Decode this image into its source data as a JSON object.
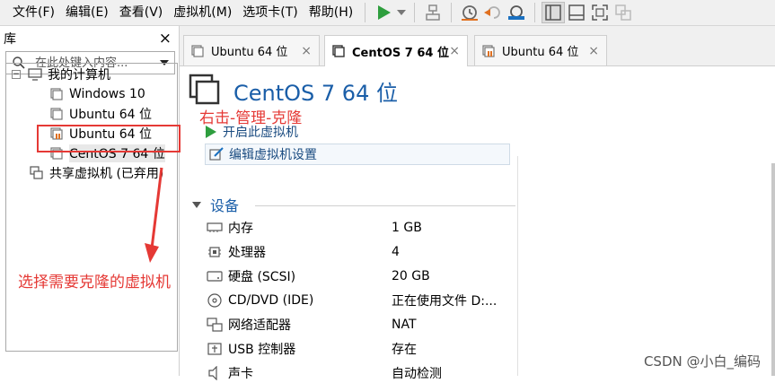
{
  "menubar": {
    "items": [
      "文件(F)",
      "编辑(E)",
      "查看(V)",
      "虚拟机(M)",
      "选项卡(T)",
      "帮助(H)"
    ]
  },
  "library": {
    "title": "库",
    "close": "×",
    "search_placeholder": "在此处键入内容...",
    "tree": {
      "root": "我的计算机",
      "vms": [
        "Windows 10",
        "Ubuntu 64 位",
        "Ubuntu 64 位",
        "CentOS 7 64 位"
      ],
      "shared": "共享虚拟机 (已弃用)"
    }
  },
  "tabs": [
    {
      "label": "Ubuntu 64 位",
      "close": "×"
    },
    {
      "label": "CentOS 7 64 位",
      "close": "×"
    },
    {
      "label": "Ubuntu 64 位",
      "close": "×"
    }
  ],
  "vm": {
    "title": "CentOS 7 64 位",
    "actions": {
      "start": "开启此虚拟机",
      "edit": "编辑虚拟机设置"
    },
    "devices_header": "设备",
    "devices": [
      {
        "name": "内存",
        "value": "1 GB",
        "icon": "memory-icon"
      },
      {
        "name": "处理器",
        "value": "4",
        "icon": "cpu-icon"
      },
      {
        "name": "硬盘 (SCSI)",
        "value": "20 GB",
        "icon": "hdd-icon"
      },
      {
        "name": "CD/DVD (IDE)",
        "value": "正在使用文件 D:...",
        "icon": "cd-icon"
      },
      {
        "name": "网络适配器",
        "value": "NAT",
        "icon": "network-icon"
      },
      {
        "name": "USB 控制器",
        "value": "存在",
        "icon": "usb-icon"
      },
      {
        "name": "声卡",
        "value": "自动检测",
        "icon": "sound-icon"
      }
    ]
  },
  "annotations": {
    "top": "右击-管理-克隆",
    "bottom": "选择需要克隆的虚拟机"
  },
  "watermark": "CSDN @小白_编码",
  "colors": {
    "accent": "#1a5ea8",
    "annotation": "#e53935",
    "play": "#2e9e3e"
  }
}
